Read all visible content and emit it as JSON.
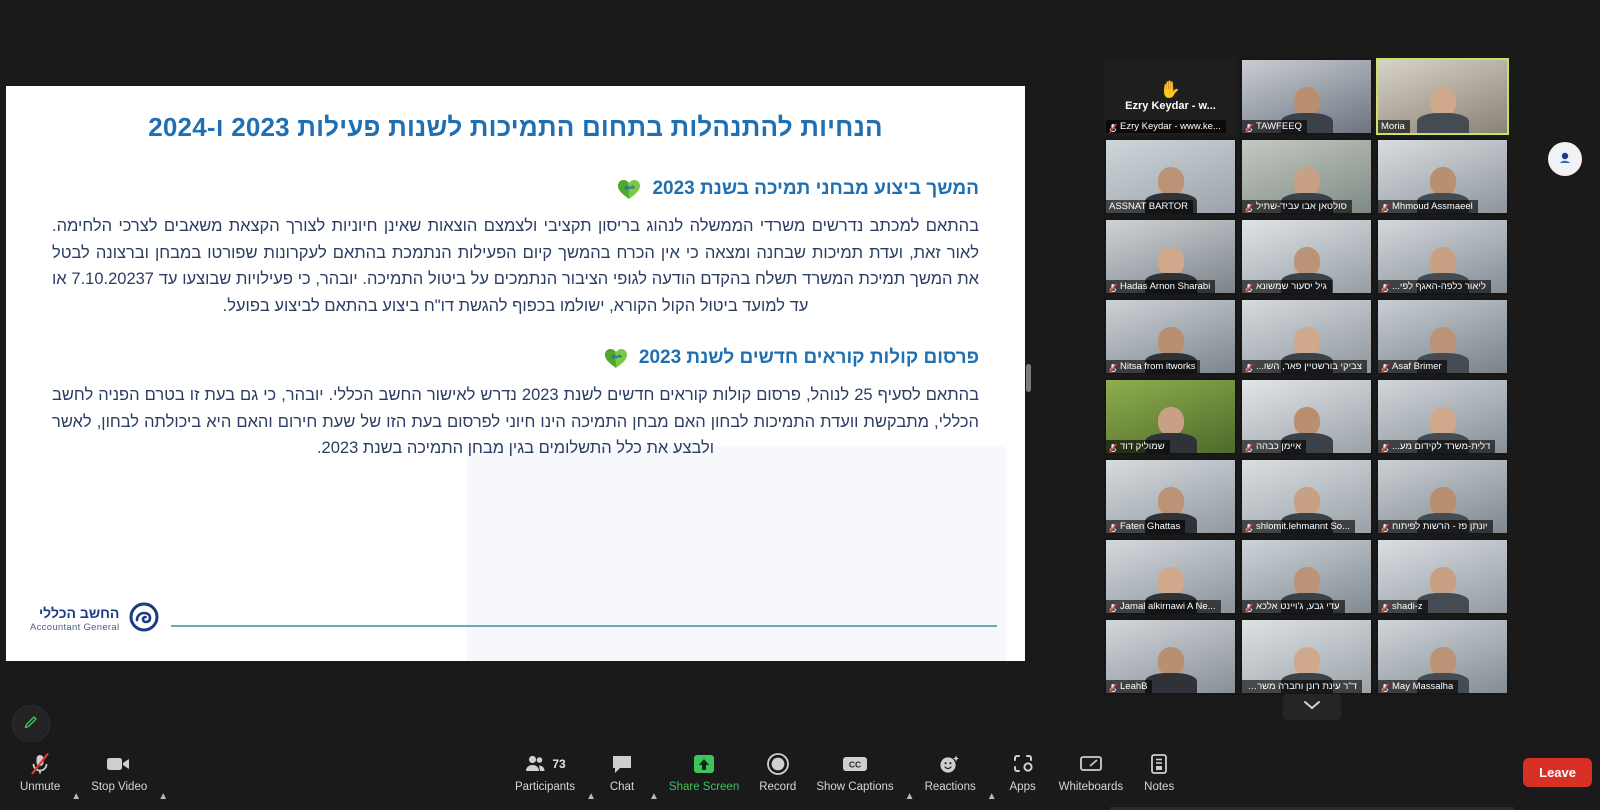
{
  "app": {
    "name": "Zoom Meeting"
  },
  "slide": {
    "title": "הנחיות להתנהלות בתחום התמיכות לשנות פעילות 2023 ו-2024",
    "sections": [
      {
        "icon": "handshake-heart-icon",
        "heading": "המשך ביצוע מבחני תמיכה בשנת 2023",
        "body": "בהתאם למכתב נדרשים משרדי הממשלה לנהוג בריסון תקציבי ולצמצם הוצאות שאינן חיוניות לצורך הקצאת משאבים לצרכי הלחימה. לאור זאת, ועדת תמיכות שבחנה ומצאה כי אין הכרח בהמשך קיום הפעילות הנתמכת בהתאם לעקרונות שפורטו במבחן וברצונה לבטל את המשך תמיכת המשרד תשלח בהקדם הודעה לגופי הציבור הנתמכים על ביטול התמיכה. יובהר, כי פעילויות שבוצעו עד 7.10.20237 או עד למועד ביטול הקול הקורא, ישולמו בכפוף להגשת דו\"ח ביצוע בהתאם לביצוע בפועל."
      },
      {
        "icon": "handshake-heart-icon",
        "heading": "פרסום קולות קוראים חדשים לשנת 2023",
        "body": "בהתאם לסעיף 25 לנוהל, פרסום קולות קוראים חדשים לשנת 2023 נדרש לאישור החשב הכללי. יובהר, כי גם בעת זו בטרם הפניה לחשב הכללי, מתבקשת וועדת התמיכות לבחון האם מבחן התמיכה הינו חיוני לפרסום בעת הזו של שעת חירום והאם היא ביכולתה לבחון, לאשר ולבצע את כלל התשלומים בגין מבחן התמיכה בשנת 2023."
      }
    ],
    "footer": {
      "logo_he": "החשב הכללי",
      "logo_en": "Accountant General",
      "logo_icon": "accountant-general-logo"
    }
  },
  "gallery": {
    "more_icon": "chevron-down-icon",
    "right_badge_icon": "profile-avatar-icon",
    "tiles": [
      {
        "name": "Ezry Keydar - www.ke...",
        "display_name": "Ezry Keydar - w...",
        "muted": true,
        "active": false,
        "raised_hand": true,
        "placeholder": true,
        "hand_icon": "raised-hand-icon"
      },
      {
        "name": "TAWFEEQ",
        "muted": true,
        "active": false
      },
      {
        "name": "Moria",
        "muted": false,
        "active": true
      },
      {
        "name": "ASSNAT BARTOR",
        "muted": false,
        "active": false
      },
      {
        "name": "סולטאן אבו עביד-שתיל",
        "muted": true,
        "active": false
      },
      {
        "name": "Mhmoud Assmaeel",
        "muted": true,
        "active": false
      },
      {
        "name": "Hadas Arnon Sharabi",
        "muted": true,
        "active": false
      },
      {
        "name": "גיל יסעור שמשונא",
        "muted": true,
        "active": false
      },
      {
        "name": "ליאור כלפה-האגף לפי...",
        "muted": true,
        "active": false
      },
      {
        "name": "Nitsa from itworks",
        "muted": true,
        "active": false
      },
      {
        "name": "צביקי בורשטיין פאר, השו...",
        "muted": true,
        "active": false
      },
      {
        "name": "Asaf Brimer",
        "muted": true,
        "active": false
      },
      {
        "name": "שמוליק דוד",
        "muted": true,
        "active": false
      },
      {
        "name": "איימן כבהה",
        "muted": true,
        "active": false
      },
      {
        "name": "דלית-משרד לקידום מע...",
        "muted": true,
        "active": false
      },
      {
        "name": "Faten Ghattas",
        "muted": true,
        "active": false
      },
      {
        "name": "shlomit.lehmannt So...",
        "muted": true,
        "active": false
      },
      {
        "name": "יונתן פז - הרשות לפיתוח",
        "muted": true,
        "active": false
      },
      {
        "name": "Jamal alkirnawi A Ne...",
        "muted": true,
        "active": false
      },
      {
        "name": "עדי גבע, ג'ויינט אלכא",
        "muted": true,
        "active": false
      },
      {
        "name": "shadi-z",
        "muted": true,
        "active": false
      },
      {
        "name": "LeahB",
        "muted": true,
        "active": false
      },
      {
        "name": "ד\"ר עינת רונן וחברה משרד...",
        "muted": false,
        "active": false
      },
      {
        "name": "May Massalha",
        "muted": true,
        "active": false
      }
    ]
  },
  "annotate": {
    "icon": "pencil-annotate-icon"
  },
  "toolbar": {
    "items": [
      {
        "label": "Unmute",
        "icon": "microphone-muted-icon",
        "caret": true,
        "green": false
      },
      {
        "label": "Stop Video",
        "icon": "video-camera-icon",
        "caret": true,
        "green": false
      },
      {
        "label": "Participants",
        "icon": "participants-icon",
        "caret": true,
        "green": false,
        "count": "73"
      },
      {
        "label": "Chat",
        "icon": "chat-bubble-icon",
        "caret": true,
        "green": false
      },
      {
        "label": "Share Screen",
        "icon": "share-screen-icon",
        "caret": false,
        "green": true
      },
      {
        "label": "Record",
        "icon": "record-icon",
        "caret": false,
        "green": false
      },
      {
        "label": "Show Captions",
        "icon": "closed-captions-icon",
        "caret": true,
        "green": false
      },
      {
        "label": "Reactions",
        "icon": "reactions-icon",
        "caret": true,
        "green": false
      },
      {
        "label": "Apps",
        "icon": "apps-icon",
        "caret": false,
        "green": false
      },
      {
        "label": "Whiteboards",
        "icon": "whiteboard-icon",
        "caret": false,
        "green": false
      },
      {
        "label": "Notes",
        "icon": "notes-icon",
        "caret": false,
        "green": false
      }
    ],
    "leave_label": "Leave"
  },
  "colors": {
    "accent_blue": "#1f6fb2",
    "body_blue": "#2b3d63",
    "leave_red": "#d93025",
    "share_green": "#3ec35a",
    "active_border": "#c9e265"
  }
}
